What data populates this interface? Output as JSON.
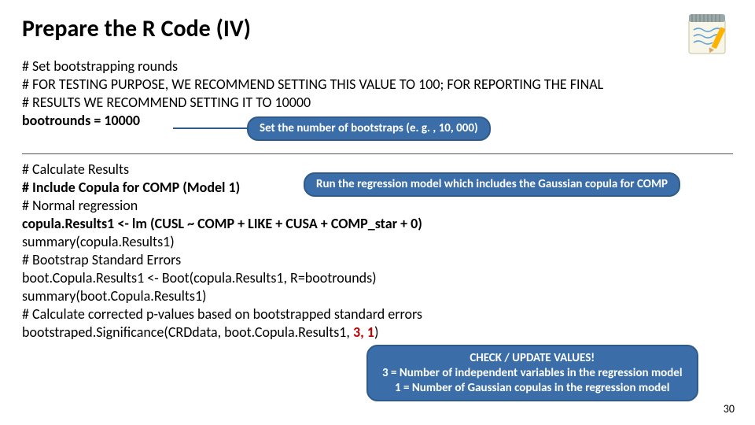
{
  "title": "Prepare the R Code (IV)",
  "section1": {
    "l1": "# Set bootstrapping rounds",
    "l2": "# FOR TESTING PURPOSE, WE RECOMMEND SETTING THIS VALUE TO 100; FOR REPORTING THE FINAL",
    "l3": "# RESULTS WE RECOMMEND SETTING IT TO 10000",
    "l4": "bootrounds = 10000"
  },
  "callout1": "Set the number of bootstraps (e. g. , 10, 000)",
  "section2": {
    "l1": "# Calculate Results",
    "l2": "# Include Copula for COMP (Model 1)",
    "l3": "# Normal regression",
    "l4": "copula.Results1 <- lm (CUSL ~ COMP + LIKE + CUSA + COMP_star + 0)",
    "l5": "summary(copula.Results1)",
    "l6": "# Bootstrap Standard Errors",
    "l7": "boot.Copula.Results1 <- Boot(copula.Results1, R=bootrounds)",
    "l8": "summary(boot.Copula.Results1)",
    "l9": "# Calculate corrected p-values based on bootstrapped standard errors",
    "l10a": "bootstraped.Significance(CRDdata, boot.Copula.Results1, ",
    "l10b": "3, 1",
    "l10c": ")"
  },
  "callout2": "Run the regression model which includes the Gaussian copula for COMP",
  "callout3": {
    "la": "CHECK / UPDATE VALUES!",
    "lb": "3 = Number of independent variables in the regression model",
    "lc": "1 = Number of Gaussian copulas in the regression model"
  },
  "pagenum": "30"
}
